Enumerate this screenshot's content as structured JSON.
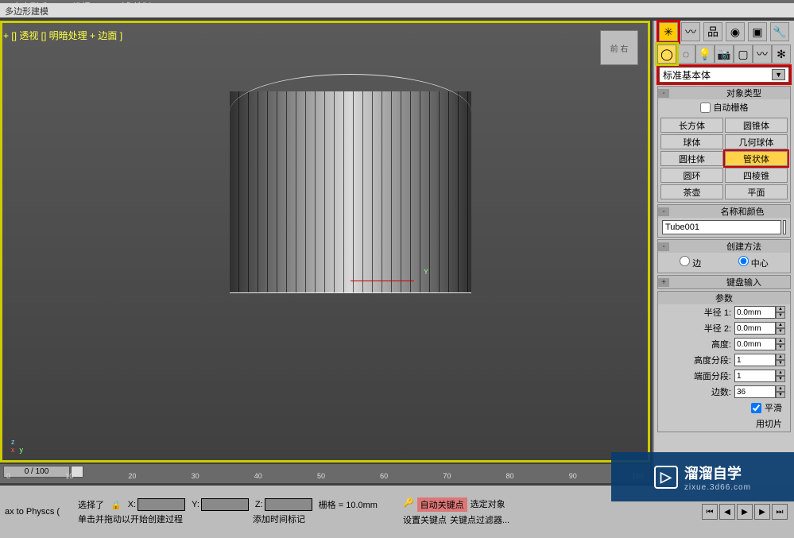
{
  "menu": {
    "graphite": "Graphite 建模工具",
    "items": [
      "自由形式",
      "选择",
      "对象绘制"
    ]
  },
  "toolbar_label": "多边形建模",
  "viewport_label": "+ [] 透视 [] 明暗处理 + 边面 ]",
  "viewcube": "前 右",
  "axis": {
    "z": "z",
    "x": "x",
    "y": "y"
  },
  "right": {
    "tabs1": [
      "create",
      "shapes",
      "lights",
      "cameras",
      "helpers",
      "space",
      "systems"
    ],
    "tabs2": [
      "standard",
      "sphere",
      "lights2",
      "bones",
      "snap",
      "waves",
      "extras"
    ],
    "dropdown": "标准基本体",
    "objtype_title": "对象类型",
    "autogrid": "自动栅格",
    "objtypes": [
      {
        "label": "长方体",
        "sel": false
      },
      {
        "label": "圆锥体",
        "sel": false
      },
      {
        "label": "球体",
        "sel": false
      },
      {
        "label": "几何球体",
        "sel": false
      },
      {
        "label": "圆柱体",
        "sel": false
      },
      {
        "label": "管状体",
        "sel": true
      },
      {
        "label": "圆环",
        "sel": false
      },
      {
        "label": "四棱锥",
        "sel": false
      },
      {
        "label": "茶壶",
        "sel": false
      },
      {
        "label": "平面",
        "sel": false
      }
    ],
    "namecolor_title": "名称和颜色",
    "name": "Tube001",
    "createmethod_title": "创建方法",
    "edge": "边",
    "center": "中心",
    "keyboardentry_title": "键盘输入",
    "params_title": "参数",
    "radius1": "半径 1:",
    "radius2": "半径 2:",
    "height": "高度:",
    "hseg": "高度分段:",
    "cseg": "端面分段:",
    "sides": "边数:",
    "r1v": "0.0mm",
    "r2v": "0.0mm",
    "hv": "0.0mm",
    "hsegv": "1",
    "csegv": "1",
    "sidesv": "36",
    "smooth": "平滑",
    "slice": "用切片"
  },
  "timeline": {
    "pos": "0 / 100",
    "ticks": [
      "0",
      "10",
      "20",
      "30",
      "40",
      "50",
      "60",
      "70",
      "80",
      "90",
      "100"
    ]
  },
  "bottom": {
    "mxstatus": "ax to Physcs (",
    "sel": "选择了",
    "x": "X:",
    "y": "Y:",
    "z": "Z:",
    "grid": "栅格 = 10.0mm",
    "hint": "单击并拖动以开始创建过程",
    "addtime": "添加时间标记",
    "autokey": "自动关键点",
    "setkey": "设置关键点",
    "selobj": "选定对象",
    "keyfilter": "关键点过滤器..."
  },
  "watermark": {
    "title": "溜溜自学",
    "sub": "zixue.3d66.com"
  },
  "chart_data": {
    "type": "other",
    "note": "3D viewport render of a tube primitive (no numeric axes to read)."
  }
}
